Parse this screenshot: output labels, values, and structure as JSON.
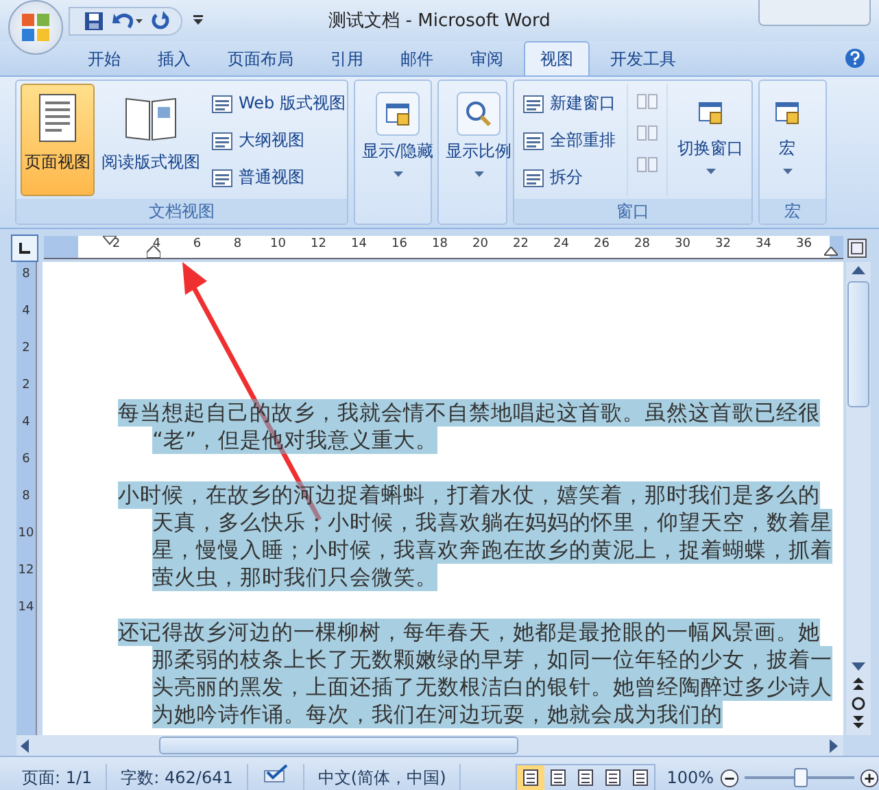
{
  "window": {
    "title": "测试文档 - Microsoft Word"
  },
  "tabs": [
    {
      "label": "开始",
      "selected": false
    },
    {
      "label": "插入",
      "selected": false
    },
    {
      "label": "页面布局",
      "selected": false
    },
    {
      "label": "引用",
      "selected": false
    },
    {
      "label": "邮件",
      "selected": false
    },
    {
      "label": "审阅",
      "selected": false
    },
    {
      "label": "视图",
      "selected": true
    },
    {
      "label": "开发工具",
      "selected": false
    }
  ],
  "ribbon_groups": [
    {
      "label": "文档视图",
      "items": [
        {
          "kind": "large",
          "label": "页面视图",
          "selected": true
        },
        {
          "kind": "large",
          "label": "阅读版式视图",
          "selected": false
        },
        {
          "kind": "small",
          "label": "Web 版式视图",
          "selected": false
        },
        {
          "kind": "small",
          "label": "大纲视图",
          "selected": false
        },
        {
          "kind": "small",
          "label": "普通视图",
          "selected": false
        }
      ]
    },
    {
      "items": [
        {
          "kind": "dropdown",
          "label": "显示/隐藏"
        }
      ]
    },
    {
      "items": [
        {
          "kind": "dropdown",
          "label": "显示比例"
        }
      ]
    },
    {
      "label": "窗口",
      "items": [
        {
          "kind": "small",
          "label": "新建窗口"
        },
        {
          "kind": "small",
          "label": "全部重排"
        },
        {
          "kind": "small",
          "label": "拆分"
        },
        {
          "kind": "icon_column",
          "disabled": true
        },
        {
          "kind": "dropdown",
          "label": "切换窗口"
        }
      ]
    },
    {
      "label": "宏",
      "items": [
        {
          "kind": "dropdown",
          "label": "宏"
        }
      ]
    }
  ],
  "ruler": {
    "h_numbers": [
      "2",
      "4",
      "6",
      "8",
      "10",
      "12",
      "14",
      "16",
      "18",
      "20",
      "22",
      "24",
      "26",
      "28",
      "30",
      "32",
      "34",
      "36"
    ],
    "v_numbers": [
      "8",
      "4",
      "2",
      "2",
      "4",
      "6",
      "8",
      "10",
      "12",
      "14"
    ]
  },
  "document": {
    "paragraphs": [
      {
        "selected": true,
        "lines": [
          "每当想起自己的故乡，我就会情不自禁地唱起这首歌。虽然这首歌已经很",
          "“老”，但是他对我意义重大。"
        ]
      },
      {
        "selected": true,
        "lines": [
          "小时候，在故乡的河边捉着蝌蚪，打着水仗，嬉笑着，那时我们是多么的",
          "天真，多么快乐；小时候，我喜欢躺在妈妈的怀里，仰望天空，数着星",
          "星，慢慢入睡；小时候，我喜欢奔跑在故乡的黄泥上，捉着蝴蝶，抓着",
          "萤火虫，那时我们只会微笑。"
        ]
      },
      {
        "selected": true,
        "lines": [
          "还记得故乡河边的一棵柳树，每年春天，她都是最抢眼的一幅风景画。她",
          "那柔弱的枝条上长了无数颗嫩绿的早芽，如同一位年轻的少女，披着一",
          "头亮丽的黑发，上面还插了无数根洁白的银针。她曾经陶醉过多少诗人",
          "为她吟诗作诵。每次，我们在河边玩耍，她就会成为我们的"
        ]
      }
    ]
  },
  "status_bar": {
    "page": "页面: 1/1",
    "words": "字数: 462/641",
    "language": "中文(简体，中国)",
    "views": [
      {
        "selected": true
      },
      {
        "selected": false
      },
      {
        "selected": false
      },
      {
        "selected": false
      },
      {
        "selected": false
      }
    ],
    "zoom": "100%",
    "zoom_slider": {
      "level": 0.5
    }
  }
}
